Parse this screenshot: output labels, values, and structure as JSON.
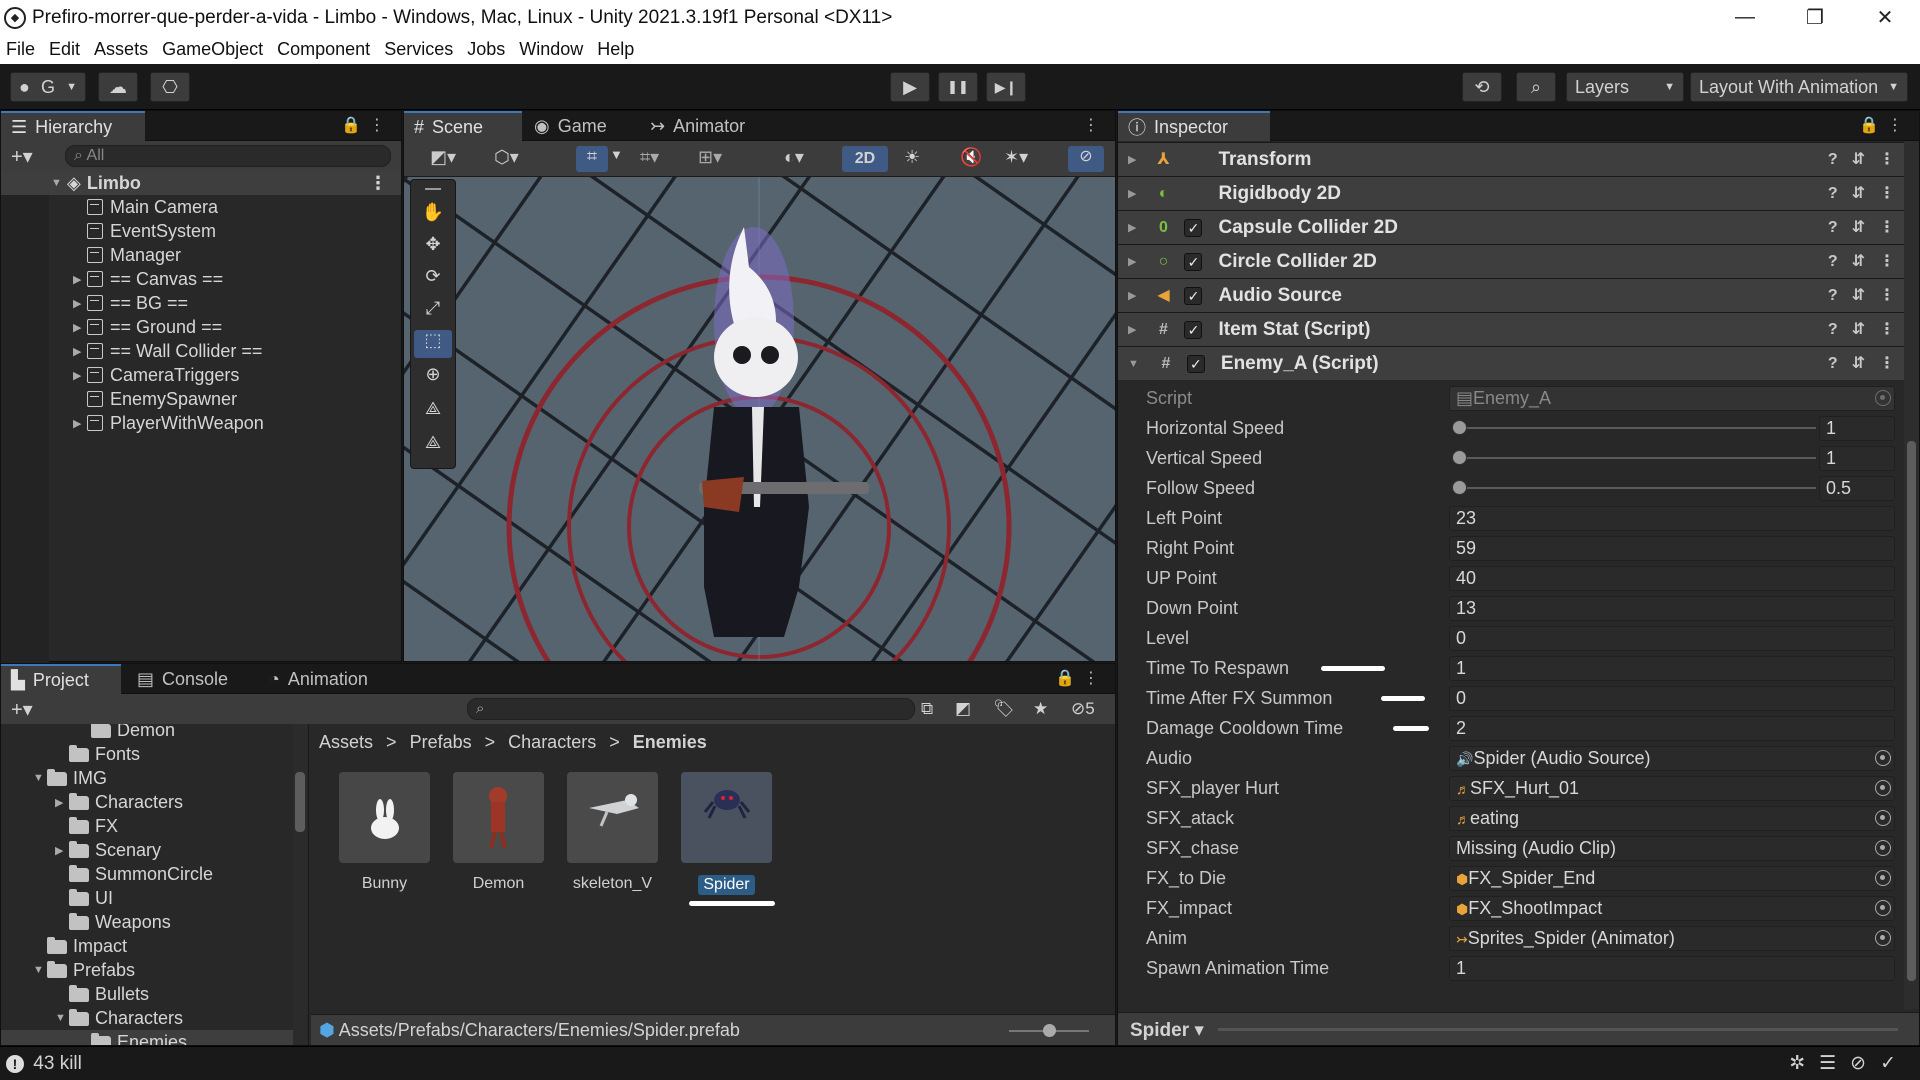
{
  "window": {
    "title": "Prefiro-morrer-que-perder-a-vida - Limbo - Windows, Mac, Linux - Unity 2021.3.19f1 Personal <DX11>",
    "controls": {
      "minimize": "—",
      "maximize": "❐",
      "close": "✕"
    }
  },
  "menu": [
    "File",
    "Edit",
    "Assets",
    "GameObject",
    "Component",
    "Services",
    "Jobs",
    "Window",
    "Help"
  ],
  "toolbar": {
    "account_label": "G",
    "play": "▶",
    "pause": "❚❚",
    "step": "▶❙",
    "layers_label": "Layers",
    "layout_label": "Layout With Animation"
  },
  "hierarchy": {
    "tab": "Hierarchy",
    "search_placeholder": "All",
    "scene": "Limbo",
    "items": [
      {
        "label": "Main Camera",
        "expandable": false
      },
      {
        "label": "EventSystem",
        "expandable": false
      },
      {
        "label": "Manager",
        "expandable": false
      },
      {
        "label": "== Canvas ==",
        "expandable": true
      },
      {
        "label": "== BG ==",
        "expandable": true
      },
      {
        "label": "== Ground ==",
        "expandable": true
      },
      {
        "label": "== Wall Collider ==",
        "expandable": true
      },
      {
        "label": "CameraTriggers",
        "expandable": true
      },
      {
        "label": "EnemySpawner",
        "expandable": false
      },
      {
        "label": "PlayerWithWeapon",
        "expandable": true
      }
    ]
  },
  "scene_view": {
    "tabs": [
      {
        "label": "Scene",
        "icon": "#"
      },
      {
        "label": "Game",
        "icon": "◉"
      },
      {
        "label": "Animator",
        "icon": "↣"
      }
    ],
    "mode_2d": "2D"
  },
  "inspector": {
    "tab": "Inspector",
    "components": [
      {
        "label": "Transform",
        "icon_color": "#e8a33a",
        "has_checkbox": false
      },
      {
        "label": "Rigidbody 2D",
        "icon_color": "#7bc043",
        "has_checkbox": false
      },
      {
        "label": "Capsule Collider 2D",
        "icon_color": "#7bc043",
        "has_checkbox": true
      },
      {
        "label": "Circle Collider 2D",
        "icon_color": "#7bc043",
        "has_checkbox": true
      },
      {
        "label": "Audio Source",
        "icon_color": "#e8a33a",
        "has_checkbox": true
      },
      {
        "label": "Item Stat (Script)",
        "icon_color": "#bbbbbb",
        "has_checkbox": true
      },
      {
        "label": "Enemy_A (Script)",
        "icon_color": "#bbbbbb",
        "has_checkbox": true
      }
    ],
    "script_label": "Script",
    "script_value": "Enemy_A",
    "sliders": [
      {
        "label": "Horizontal Speed",
        "value": "1",
        "fraction": 0.0
      },
      {
        "label": "Vertical Speed",
        "value": "1",
        "fraction": 0.0
      },
      {
        "label": "Follow Speed",
        "value": "0.5",
        "fraction": 0.0
      }
    ],
    "fields": [
      {
        "label": "Left Point",
        "value": "23"
      },
      {
        "label": "Right Point",
        "value": "59"
      },
      {
        "label": "UP Point",
        "value": "40"
      },
      {
        "label": "Down Point",
        "value": "13"
      },
      {
        "label": "Level",
        "value": "0"
      },
      {
        "label": "Time To Respawn",
        "value": "1"
      },
      {
        "label": "Time After FX Summon",
        "value": "0"
      },
      {
        "label": "Damage Cooldown Time",
        "value": "2"
      }
    ],
    "refs": [
      {
        "label": "Audio",
        "value": "Spider (Audio Source)",
        "icon": "🔊"
      },
      {
        "label": "SFX_player Hurt",
        "value": "SFX_Hurt_01",
        "icon": "♬"
      },
      {
        "label": "SFX_atack",
        "value": "eating",
        "icon": "♬"
      },
      {
        "label": "SFX_chase",
        "value": "Missing (Audio Clip)",
        "icon": ""
      },
      {
        "label": "FX_to Die",
        "value": "FX_Spider_End",
        "icon": "⬢"
      },
      {
        "label": "FX_impact",
        "value": "FX_ShootImpact",
        "icon": "⬢"
      },
      {
        "label": "Anim",
        "value": "Sprites_Spider (Animator)",
        "icon": "↣"
      }
    ],
    "last_field": {
      "label": "Spawn Animation Time",
      "value": "1"
    },
    "footer_object": "Spider ▾"
  },
  "project": {
    "tabs": [
      {
        "label": "Project",
        "icon": "▙"
      },
      {
        "label": "Console",
        "icon": "▤"
      },
      {
        "label": "Animation",
        "icon": "◔"
      }
    ],
    "hidden_count": "5",
    "tree": [
      {
        "label": "Demon",
        "indent": 3,
        "arrow": ""
      },
      {
        "label": "Fonts",
        "indent": 2,
        "arrow": ""
      },
      {
        "label": "IMG",
        "indent": 1,
        "arrow": "▼"
      },
      {
        "label": "Characters",
        "indent": 2,
        "arrow": "▶"
      },
      {
        "label": "FX",
        "indent": 2,
        "arrow": ""
      },
      {
        "label": "Scenary",
        "indent": 2,
        "arrow": "▶"
      },
      {
        "label": "SummonCircle",
        "indent": 2,
        "arrow": ""
      },
      {
        "label": "UI",
        "indent": 2,
        "arrow": ""
      },
      {
        "label": "Weapons",
        "indent": 2,
        "arrow": ""
      },
      {
        "label": "Impact",
        "indent": 1,
        "arrow": ""
      },
      {
        "label": "Prefabs",
        "indent": 1,
        "arrow": "▼"
      },
      {
        "label": "Bullets",
        "indent": 2,
        "arrow": ""
      },
      {
        "label": "Characters",
        "indent": 2,
        "arrow": "▼"
      },
      {
        "label": "Enemies",
        "indent": 3,
        "arrow": ""
      }
    ],
    "breadcrumb": [
      "Assets",
      "Prefabs",
      "Characters",
      "Enemies"
    ],
    "assets": [
      {
        "label": "Bunny"
      },
      {
        "label": "Demon"
      },
      {
        "label": "skeleton_V"
      },
      {
        "label": "Spider"
      }
    ],
    "path": "Assets/Prefabs/Characters/Enemies/Spider.prefab",
    "zoom_fraction": 0.5
  },
  "status": {
    "text": "43 kill"
  }
}
